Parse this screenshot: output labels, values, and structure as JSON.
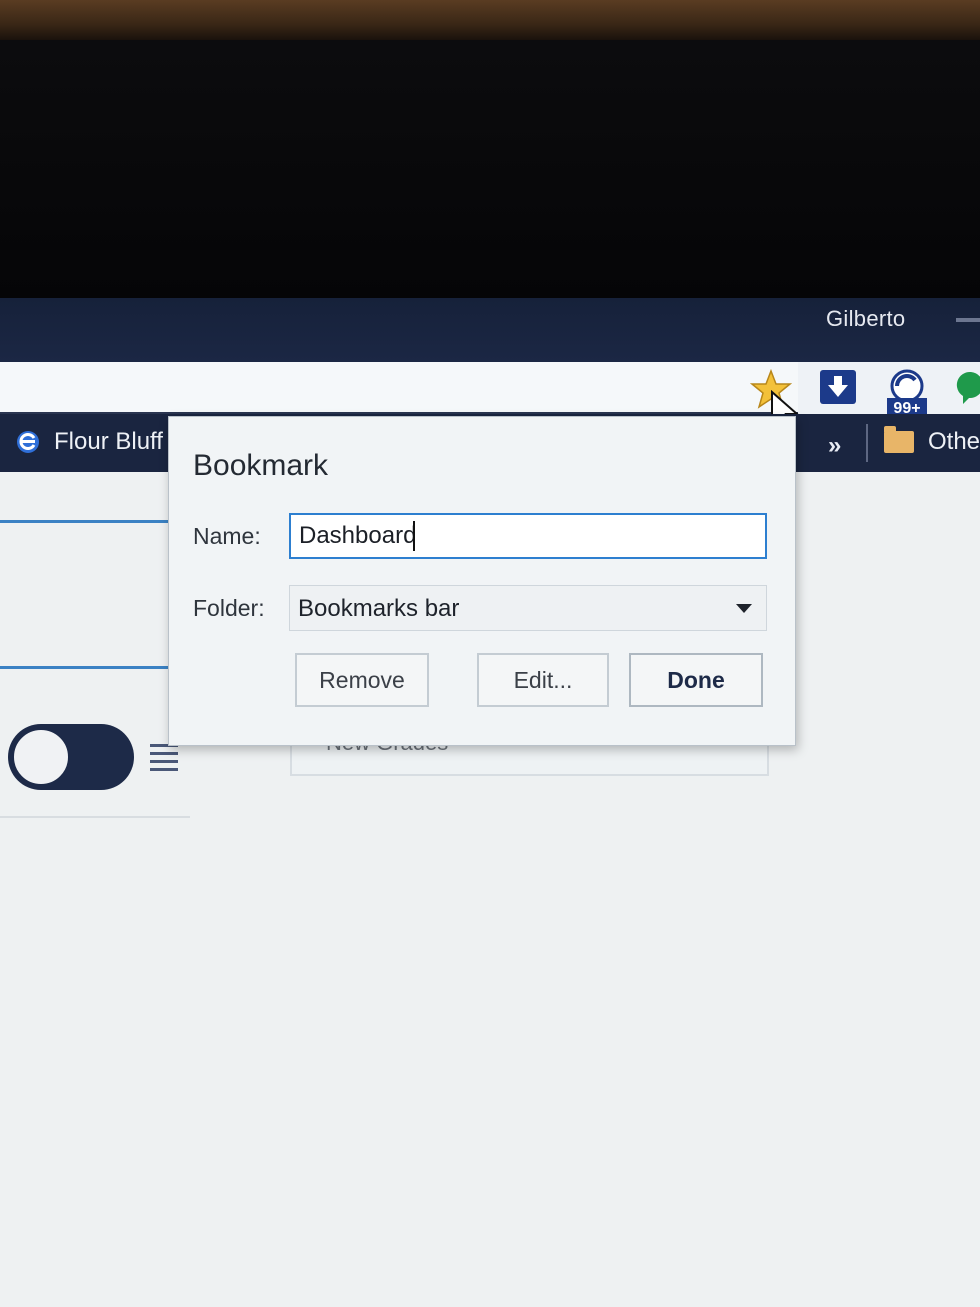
{
  "window": {
    "profile_name": "Gilberto"
  },
  "toolbar": {
    "bookmark_star": "star-icon",
    "extensions": [
      "download-icon",
      "sync-icon",
      "hangouts-icon"
    ],
    "extension_badge": "99+"
  },
  "bookmarks_bar": {
    "items": [
      {
        "label": "Flour Bluff",
        "icon": "ie-icon"
      }
    ],
    "overflow": "»",
    "other": {
      "label": "Othe",
      "icon": "folder-icon"
    }
  },
  "page": {
    "ghost_text": "New Grades"
  },
  "dialog": {
    "title": "Bookmark",
    "name_label": "Name:",
    "name_value": "Dashboard",
    "folder_label": "Folder:",
    "folder_value": "Bookmarks bar",
    "buttons": {
      "remove": "Remove",
      "edit": "Edit...",
      "done": "Done"
    }
  },
  "colors": {
    "titlebar": "#16213a",
    "bookmarks_bar": "#1a2540",
    "focus_border": "#2d7fd0",
    "star": "#f3c13a"
  }
}
